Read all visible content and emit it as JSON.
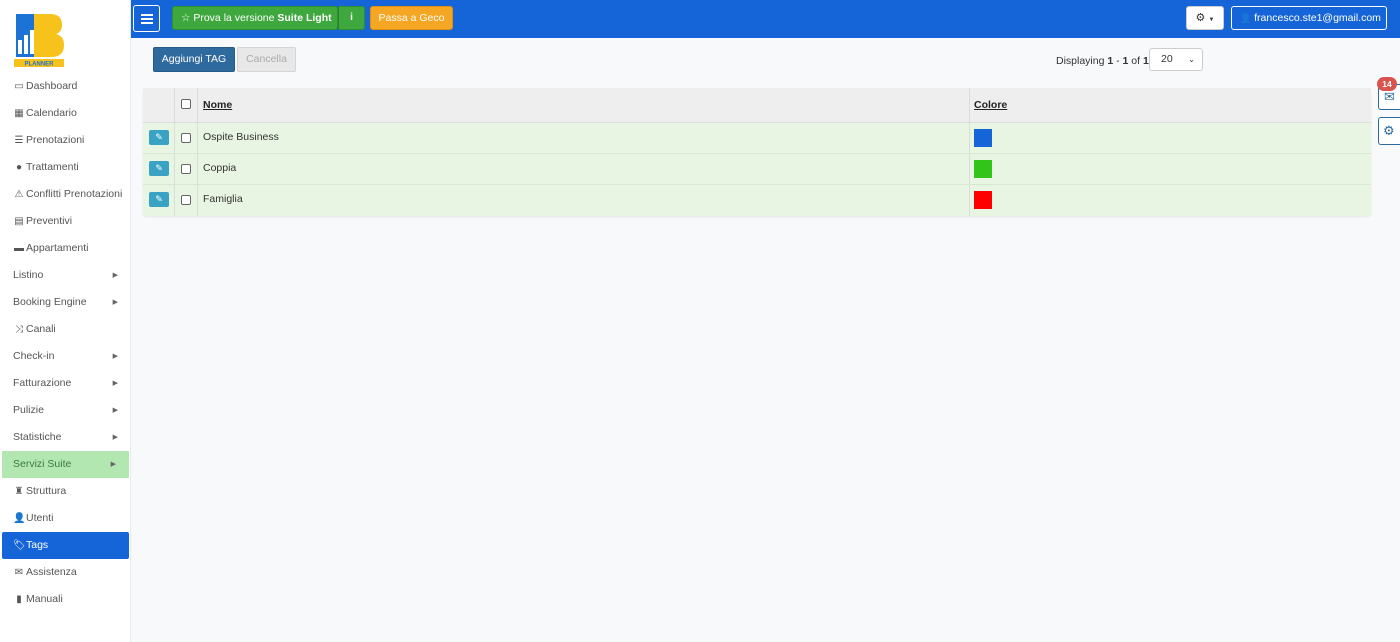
{
  "topbar": {
    "suite_prefix": "Prova la versione",
    "suite_bold": "Suite Light",
    "info_label": "i",
    "geco_label": "Passa a Geco",
    "user_email": "francesco.ste1@gmail.com",
    "star_icon": "☆",
    "gear_icon": "⚙",
    "user_icon": "👤"
  },
  "sidebar": {
    "logo_text": "PLANNER",
    "items": [
      {
        "label": "Dashboard",
        "icon": "▭",
        "caret": ""
      },
      {
        "label": "Calendario",
        "icon": "▦",
        "caret": ""
      },
      {
        "label": "Prenotazioni",
        "icon": "☰",
        "caret": ""
      },
      {
        "label": "Trattamenti",
        "icon": "●",
        "caret": ""
      },
      {
        "label": "Conflitti Prenotazioni",
        "icon": "⚠",
        "caret": ""
      },
      {
        "label": "Preventivi",
        "icon": "▤",
        "caret": ""
      },
      {
        "label": "Appartamenti",
        "icon": "▬",
        "caret": ""
      },
      {
        "label": "Listino",
        "icon": "",
        "caret": "▶"
      },
      {
        "label": "Booking Engine",
        "icon": "",
        "caret": "▶"
      },
      {
        "label": "Canali",
        "icon": "⤨",
        "caret": ""
      },
      {
        "label": "Check-in",
        "icon": "",
        "caret": "▶"
      },
      {
        "label": "Fatturazione",
        "icon": "",
        "caret": "▶"
      },
      {
        "label": "Pulizie",
        "icon": "",
        "caret": "▶"
      },
      {
        "label": "Statistiche",
        "icon": "",
        "caret": "▶"
      },
      {
        "label": "Servizi Suite",
        "icon": "",
        "caret": "▶"
      },
      {
        "label": "Struttura",
        "icon": "♜",
        "caret": ""
      },
      {
        "label": "Utenti",
        "icon": "👤",
        "caret": ""
      },
      {
        "label": "Tags",
        "icon": "🏷",
        "caret": ""
      },
      {
        "label": "Assistenza",
        "icon": "✉",
        "caret": ""
      },
      {
        "label": "Manuali",
        "icon": "▮",
        "caret": ""
      }
    ]
  },
  "toolbar": {
    "add_label": "Aggiungi TAG",
    "delete_label": "Cancella"
  },
  "pager": {
    "prefix": "Displaying ",
    "from": "1",
    "sep": " - ",
    "to": "1",
    "of": " of ",
    "total": "1",
    "page_size": "20"
  },
  "table": {
    "col_name": "Nome",
    "col_color": "Colore",
    "rows": [
      {
        "name": "Ospite Business",
        "color": "#1565d8"
      },
      {
        "name": "Coppia",
        "color": "#33c41a"
      },
      {
        "name": "Famiglia",
        "color": "#ff0000"
      }
    ]
  },
  "floating": {
    "mail_badge": "14",
    "mail_icon": "✉",
    "gear_icon": "⚙"
  }
}
